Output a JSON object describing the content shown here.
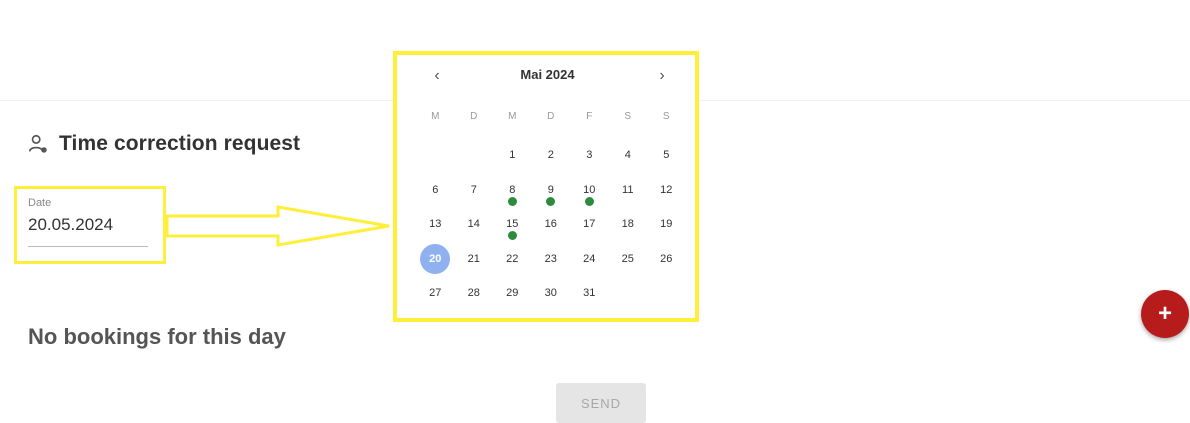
{
  "page": {
    "title": "Time correction request",
    "title_icon": "person-icon"
  },
  "date_field": {
    "label": "Date",
    "value": "20.05.2024"
  },
  "calendar": {
    "month_label": "Mai 2024",
    "prev_icon": "chevron-left-icon",
    "next_icon": "chevron-right-icon",
    "weekdays": [
      "M",
      "D",
      "M",
      "D",
      "F",
      "S",
      "S"
    ],
    "weeks": [
      [
        "",
        "",
        "1",
        "2",
        "3",
        "4",
        "5"
      ],
      [
        "6",
        "7",
        "8",
        "9",
        "10",
        "11",
        "12"
      ],
      [
        "13",
        "14",
        "15",
        "16",
        "17",
        "18",
        "19"
      ],
      [
        "20",
        "21",
        "22",
        "23",
        "24",
        "25",
        "26"
      ],
      [
        "27",
        "28",
        "29",
        "30",
        "31",
        "",
        ""
      ]
    ],
    "selected_day": "20",
    "marked_days": [
      "8",
      "9",
      "10",
      "15"
    ],
    "marker_color": "#2e8b3d",
    "selected_color": "#8fb1f0"
  },
  "empty_state": {
    "message": "No bookings for this day"
  },
  "actions": {
    "send_label": "SEND",
    "fab_label": "+",
    "fab_color": "#b71c1c"
  },
  "highlight_color": "#ffef3a"
}
